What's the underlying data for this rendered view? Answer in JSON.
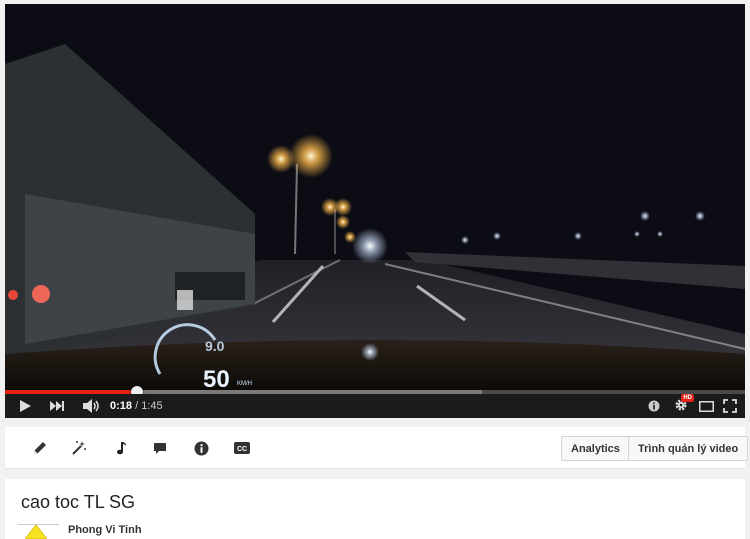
{
  "player": {
    "scene_description_icon": "night-highway-video",
    "hud": {
      "speed": "50",
      "speed_unit": "KM/H",
      "trip": "9.0"
    },
    "progress": {
      "played_fraction": 0.179,
      "loaded_fraction": 0.645
    },
    "time": {
      "current": "0:18",
      "separator": " / ",
      "total": "1:45"
    },
    "controls": {
      "play_icon": "play-icon",
      "next_icon": "next-icon",
      "volume_icon": "volume-icon",
      "annotations_icon": "info-icon",
      "settings_icon": "gear-icon",
      "hd_badge": "HD",
      "theater_icon": "theater-icon",
      "fullscreen_icon": "fullscreen-icon"
    },
    "colors": {
      "progress_played": "#e62117",
      "controls_bg": "#1b1b1b"
    }
  },
  "toolbar": {
    "tools": [
      "pencil-icon",
      "magic-wand-icon",
      "music-note-icon",
      "comment-icon",
      "info-icon",
      "cc-icon"
    ],
    "cc_label": "CC",
    "analytics_label": "Analytics",
    "video_manager_label": "Trình quản lý video"
  },
  "video_info": {
    "title": "cao toc TL SG",
    "channel": "Phong Vi Tinh"
  }
}
